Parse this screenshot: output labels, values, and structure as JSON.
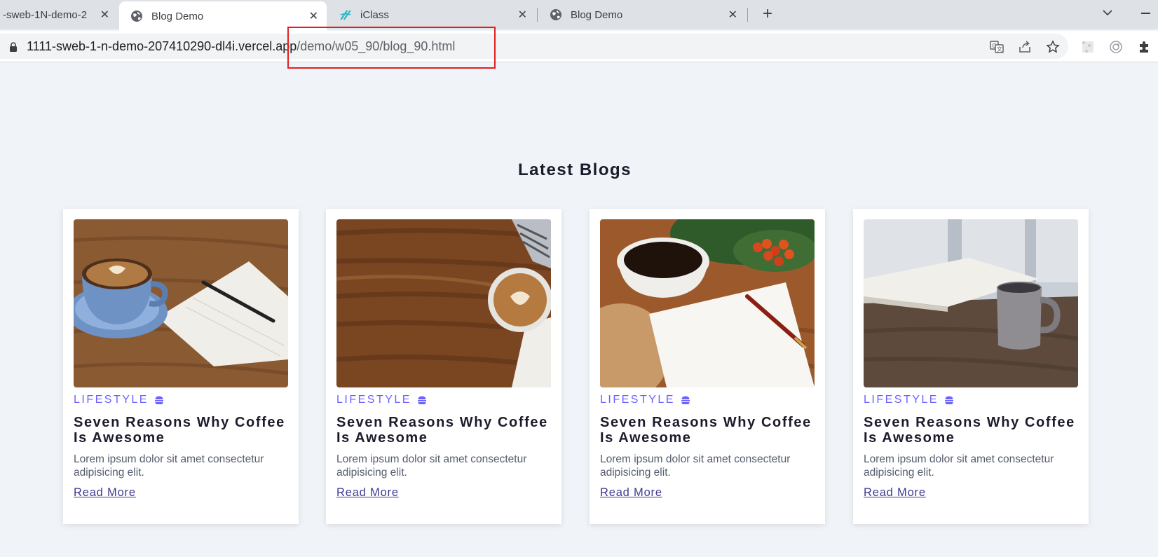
{
  "browser": {
    "tabs": [
      {
        "title": "-sweb-1N-demo-2",
        "active": false,
        "favicon": "none"
      },
      {
        "title": "Blog Demo",
        "active": true,
        "favicon": "globe-icon"
      },
      {
        "title": "iClass",
        "active": false,
        "favicon": "iclass-logo-icon"
      },
      {
        "title": "Blog Demo",
        "active": false,
        "favicon": "globe-icon"
      }
    ],
    "close_glyph": "✕",
    "new_tab_glyph": "+",
    "url_host": "1111-sweb-1-n-demo-207410290-dl4i.vercel.app",
    "url_path": "/demo/w05_90/blog_90.html",
    "toolbar_icons": [
      "translate-icon",
      "share-icon",
      "bookmark-star-icon",
      "extension-puzzle-1-icon",
      "extension-2-icon",
      "extensions-icon"
    ]
  },
  "page": {
    "title": "Latest Blogs",
    "cards": [
      {
        "category": "LIFESTYLE",
        "heading": "Seven Reasons Why Coffee Is Awesome",
        "excerpt": "Lorem ipsum dolor sit amet consectetur adipisicing elit.",
        "link": "Read More",
        "image": "coffee-notebook-pen-image"
      },
      {
        "category": "LIFESTYLE",
        "heading": "Seven Reasons Why Coffee Is Awesome",
        "excerpt": "Lorem ipsum dolor sit amet consectetur adipisicing elit.",
        "link": "Read More",
        "image": "coffee-on-wood-table-image"
      },
      {
        "category": "LIFESTYLE",
        "heading": "Seven Reasons Why Coffee Is Awesome",
        "excerpt": "Lorem ipsum dolor sit amet consectetur adipisicing elit.",
        "link": "Read More",
        "image": "coffee-paper-pen-berries-image"
      },
      {
        "category": "LIFESTYLE",
        "heading": "Seven Reasons Why Coffee Is Awesome",
        "excerpt": "Lorem ipsum dolor sit amet consectetur adipisicing elit.",
        "link": "Read More",
        "image": "grey-mug-open-book-image"
      }
    ],
    "colors": {
      "accent": "#6c63ff",
      "link": "#3f3a92",
      "background": "#f0f3f7",
      "highlight": "#e02020"
    }
  }
}
